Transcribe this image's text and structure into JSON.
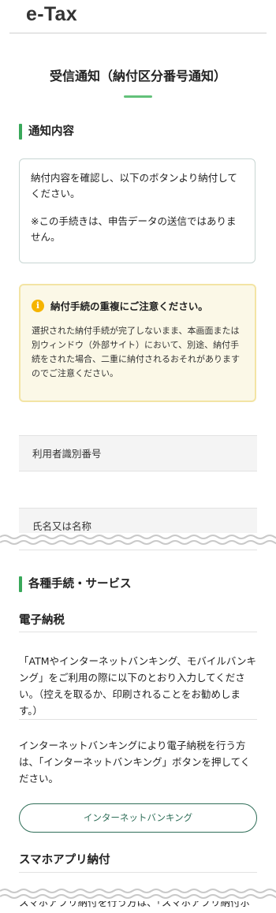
{
  "header": {
    "logo": "e-Tax"
  },
  "page_title": "受信通知（納付区分番号通知）",
  "notice_section": {
    "heading": "通知内容",
    "info_lines": [
      "納付内容を確認し、以下のボタンより納付してください。",
      "※この手続きは、申告データの送信ではありません。"
    ]
  },
  "warning": {
    "icon": "info-icon",
    "title": "納付手続の重複にご注意ください。",
    "body": "選択された納付手続が完了しないまま、本画面または別ウィンドウ（外部サイト）において、別途、納付手続をされた場合、二重に納付されるおそれがありますのでご注意ください。",
    "colors": {
      "background": "#fbf8e7",
      "border": "#f3e4a4",
      "icon": "#f5b400"
    }
  },
  "fields": {
    "user_id_label": "利用者識別番号",
    "name_label": "氏名又は名称"
  },
  "services": {
    "heading": "各種手続・サービス",
    "e_payment": {
      "heading": "電子納税",
      "para1": "「ATMやインターネットバンキング、モバイルバンキング」をご利用の際に以下のとおり入力してください。（控えを取るか、印刷されることをお勧めします。）",
      "para2": "インターネットバンキングにより電子納税を行う方は、「インターネットバンキング」ボタンを押してください。",
      "button_label": "インターネットバンキング"
    },
    "app_payment": {
      "heading": "スマホアプリ納付",
      "para_cut": "スマホアプリ納付を行う方は、「スマホアプリ納付ボ"
    }
  },
  "accent_color": "#39a85a"
}
